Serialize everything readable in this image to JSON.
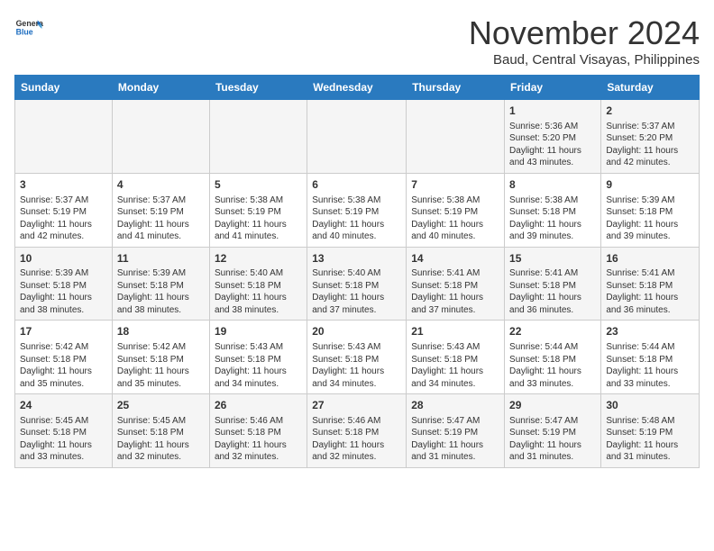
{
  "header": {
    "logo_general": "General",
    "logo_blue": "Blue",
    "month_year": "November 2024",
    "location": "Baud, Central Visayas, Philippines"
  },
  "calendar": {
    "days_of_week": [
      "Sunday",
      "Monday",
      "Tuesday",
      "Wednesday",
      "Thursday",
      "Friday",
      "Saturday"
    ],
    "weeks": [
      [
        {
          "day": "",
          "info": ""
        },
        {
          "day": "",
          "info": ""
        },
        {
          "day": "",
          "info": ""
        },
        {
          "day": "",
          "info": ""
        },
        {
          "day": "",
          "info": ""
        },
        {
          "day": "1",
          "info": "Sunrise: 5:36 AM\nSunset: 5:20 PM\nDaylight: 11 hours and 43 minutes."
        },
        {
          "day": "2",
          "info": "Sunrise: 5:37 AM\nSunset: 5:20 PM\nDaylight: 11 hours and 42 minutes."
        }
      ],
      [
        {
          "day": "3",
          "info": "Sunrise: 5:37 AM\nSunset: 5:19 PM\nDaylight: 11 hours and 42 minutes."
        },
        {
          "day": "4",
          "info": "Sunrise: 5:37 AM\nSunset: 5:19 PM\nDaylight: 11 hours and 41 minutes."
        },
        {
          "day": "5",
          "info": "Sunrise: 5:38 AM\nSunset: 5:19 PM\nDaylight: 11 hours and 41 minutes."
        },
        {
          "day": "6",
          "info": "Sunrise: 5:38 AM\nSunset: 5:19 PM\nDaylight: 11 hours and 40 minutes."
        },
        {
          "day": "7",
          "info": "Sunrise: 5:38 AM\nSunset: 5:19 PM\nDaylight: 11 hours and 40 minutes."
        },
        {
          "day": "8",
          "info": "Sunrise: 5:38 AM\nSunset: 5:18 PM\nDaylight: 11 hours and 39 minutes."
        },
        {
          "day": "9",
          "info": "Sunrise: 5:39 AM\nSunset: 5:18 PM\nDaylight: 11 hours and 39 minutes."
        }
      ],
      [
        {
          "day": "10",
          "info": "Sunrise: 5:39 AM\nSunset: 5:18 PM\nDaylight: 11 hours and 38 minutes."
        },
        {
          "day": "11",
          "info": "Sunrise: 5:39 AM\nSunset: 5:18 PM\nDaylight: 11 hours and 38 minutes."
        },
        {
          "day": "12",
          "info": "Sunrise: 5:40 AM\nSunset: 5:18 PM\nDaylight: 11 hours and 38 minutes."
        },
        {
          "day": "13",
          "info": "Sunrise: 5:40 AM\nSunset: 5:18 PM\nDaylight: 11 hours and 37 minutes."
        },
        {
          "day": "14",
          "info": "Sunrise: 5:41 AM\nSunset: 5:18 PM\nDaylight: 11 hours and 37 minutes."
        },
        {
          "day": "15",
          "info": "Sunrise: 5:41 AM\nSunset: 5:18 PM\nDaylight: 11 hours and 36 minutes."
        },
        {
          "day": "16",
          "info": "Sunrise: 5:41 AM\nSunset: 5:18 PM\nDaylight: 11 hours and 36 minutes."
        }
      ],
      [
        {
          "day": "17",
          "info": "Sunrise: 5:42 AM\nSunset: 5:18 PM\nDaylight: 11 hours and 35 minutes."
        },
        {
          "day": "18",
          "info": "Sunrise: 5:42 AM\nSunset: 5:18 PM\nDaylight: 11 hours and 35 minutes."
        },
        {
          "day": "19",
          "info": "Sunrise: 5:43 AM\nSunset: 5:18 PM\nDaylight: 11 hours and 34 minutes."
        },
        {
          "day": "20",
          "info": "Sunrise: 5:43 AM\nSunset: 5:18 PM\nDaylight: 11 hours and 34 minutes."
        },
        {
          "day": "21",
          "info": "Sunrise: 5:43 AM\nSunset: 5:18 PM\nDaylight: 11 hours and 34 minutes."
        },
        {
          "day": "22",
          "info": "Sunrise: 5:44 AM\nSunset: 5:18 PM\nDaylight: 11 hours and 33 minutes."
        },
        {
          "day": "23",
          "info": "Sunrise: 5:44 AM\nSunset: 5:18 PM\nDaylight: 11 hours and 33 minutes."
        }
      ],
      [
        {
          "day": "24",
          "info": "Sunrise: 5:45 AM\nSunset: 5:18 PM\nDaylight: 11 hours and 33 minutes."
        },
        {
          "day": "25",
          "info": "Sunrise: 5:45 AM\nSunset: 5:18 PM\nDaylight: 11 hours and 32 minutes."
        },
        {
          "day": "26",
          "info": "Sunrise: 5:46 AM\nSunset: 5:18 PM\nDaylight: 11 hours and 32 minutes."
        },
        {
          "day": "27",
          "info": "Sunrise: 5:46 AM\nSunset: 5:18 PM\nDaylight: 11 hours and 32 minutes."
        },
        {
          "day": "28",
          "info": "Sunrise: 5:47 AM\nSunset: 5:19 PM\nDaylight: 11 hours and 31 minutes."
        },
        {
          "day": "29",
          "info": "Sunrise: 5:47 AM\nSunset: 5:19 PM\nDaylight: 11 hours and 31 minutes."
        },
        {
          "day": "30",
          "info": "Sunrise: 5:48 AM\nSunset: 5:19 PM\nDaylight: 11 hours and 31 minutes."
        }
      ]
    ]
  }
}
